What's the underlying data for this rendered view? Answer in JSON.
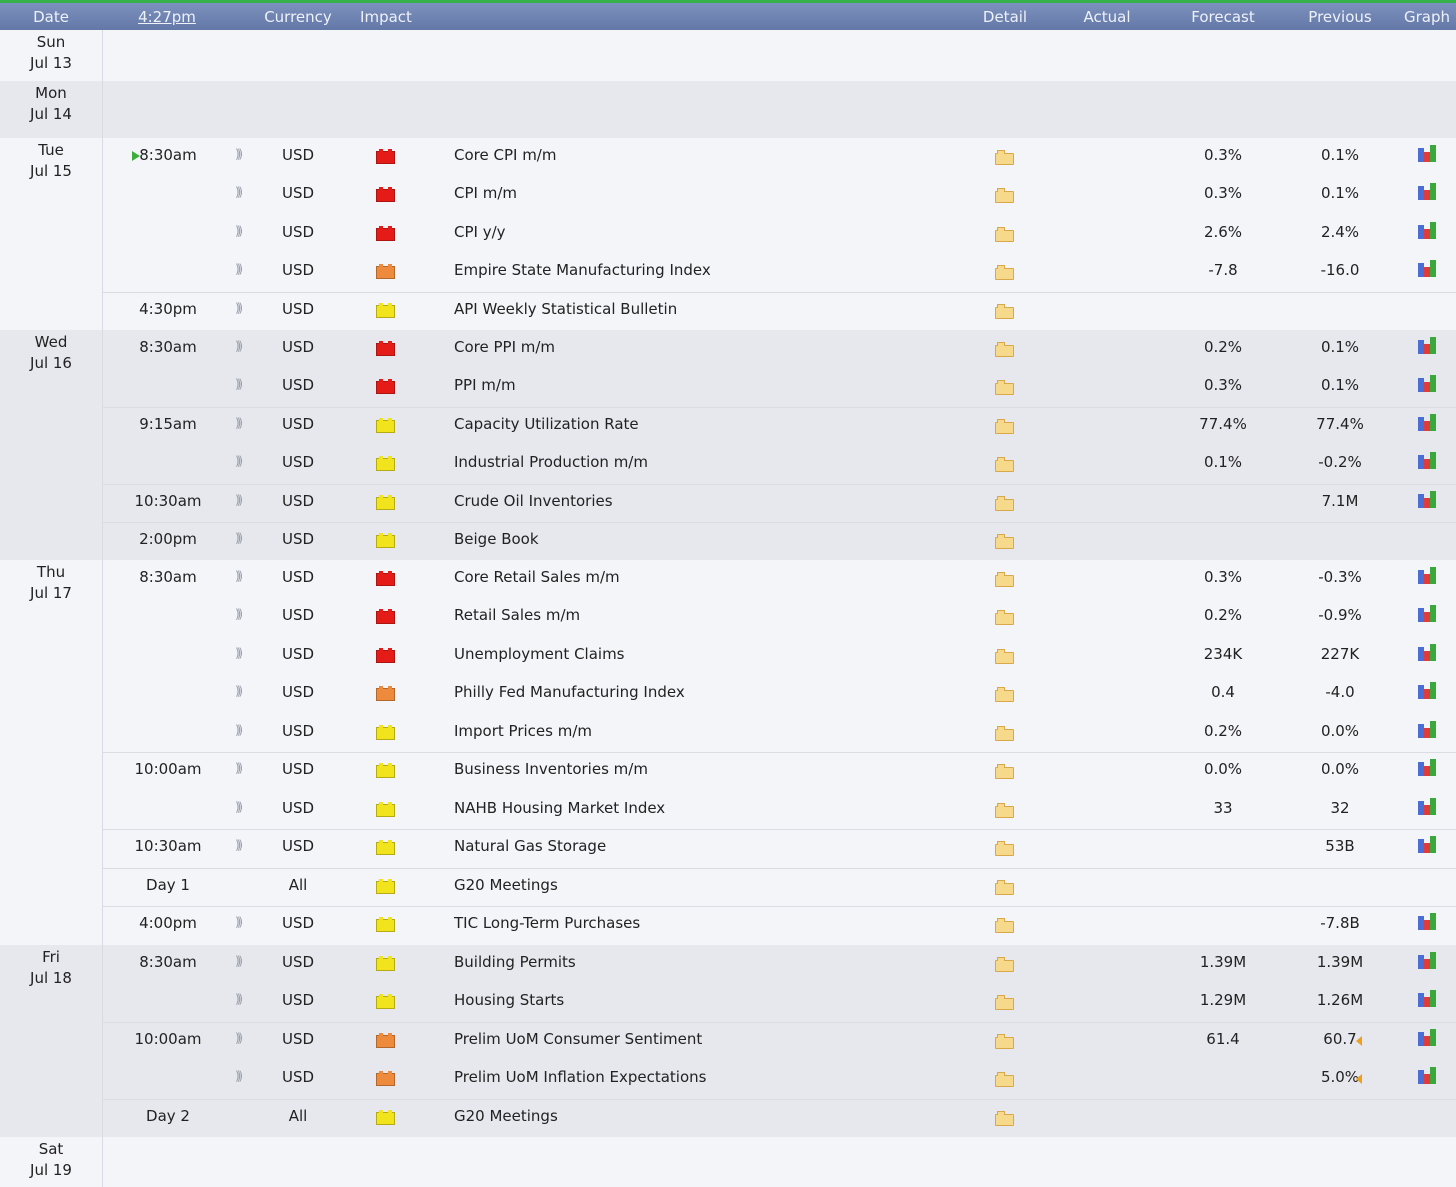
{
  "header": {
    "date": "Date",
    "time": "4:27pm",
    "currency": "Currency",
    "impact": "Impact",
    "detail": "Detail",
    "actual": "Actual",
    "forecast": "Forecast",
    "previous": "Previous",
    "graph": "Graph"
  },
  "colors": {
    "high": "#e41b17",
    "medium": "#ee8a3c",
    "low": "#f1e41c",
    "header": "#6f84b3",
    "top_accent": "#37b24a"
  },
  "days": [
    {
      "dow": "Sun",
      "date": "Jul 13",
      "rows": []
    },
    {
      "dow": "Mon",
      "date": "Jul 14",
      "rows": []
    },
    {
      "dow": "Tue",
      "date": "Jul 15",
      "rows": [
        {
          "time": "8:30am",
          "next": true,
          "currency": "USD",
          "impact": "high",
          "title": "Core CPI m/m",
          "forecast": "0.3%",
          "previous": "0.1%",
          "graph": true
        },
        {
          "time": "",
          "currency": "USD",
          "impact": "high",
          "title": "CPI m/m",
          "forecast": "0.3%",
          "previous": "0.1%",
          "graph": true
        },
        {
          "time": "",
          "currency": "USD",
          "impact": "high",
          "title": "CPI y/y",
          "forecast": "2.6%",
          "previous": "2.4%",
          "graph": true
        },
        {
          "time": "",
          "currency": "USD",
          "impact": "medium",
          "title": "Empire State Manufacturing Index",
          "forecast": "-7.8",
          "previous": "-16.0",
          "graph": true
        },
        {
          "time": "4:30pm",
          "sep": true,
          "currency": "USD",
          "impact": "low",
          "title": "API Weekly Statistical Bulletin",
          "forecast": "",
          "previous": "",
          "graph": false
        }
      ]
    },
    {
      "dow": "Wed",
      "date": "Jul 16",
      "rows": [
        {
          "time": "8:30am",
          "currency": "USD",
          "impact": "high",
          "title": "Core PPI m/m",
          "forecast": "0.2%",
          "previous": "0.1%",
          "graph": true
        },
        {
          "time": "",
          "currency": "USD",
          "impact": "high",
          "title": "PPI m/m",
          "forecast": "0.3%",
          "previous": "0.1%",
          "graph": true
        },
        {
          "time": "9:15am",
          "sep": true,
          "currency": "USD",
          "impact": "low",
          "title": "Capacity Utilization Rate",
          "forecast": "77.4%",
          "previous": "77.4%",
          "graph": true
        },
        {
          "time": "",
          "currency": "USD",
          "impact": "low",
          "title": "Industrial Production m/m",
          "forecast": "0.1%",
          "previous": "-0.2%",
          "graph": true
        },
        {
          "time": "10:30am",
          "sep": true,
          "currency": "USD",
          "impact": "low",
          "title": "Crude Oil Inventories",
          "forecast": "",
          "previous": "7.1M",
          "graph": true
        },
        {
          "time": "2:00pm",
          "sep": true,
          "currency": "USD",
          "impact": "low",
          "title": "Beige Book",
          "forecast": "",
          "previous": "",
          "graph": false
        }
      ]
    },
    {
      "dow": "Thu",
      "date": "Jul 17",
      "rows": [
        {
          "time": "8:30am",
          "currency": "USD",
          "impact": "high",
          "title": "Core Retail Sales m/m",
          "forecast": "0.3%",
          "previous": "-0.3%",
          "graph": true
        },
        {
          "time": "",
          "currency": "USD",
          "impact": "high",
          "title": "Retail Sales m/m",
          "forecast": "0.2%",
          "previous": "-0.9%",
          "graph": true
        },
        {
          "time": "",
          "currency": "USD",
          "impact": "high",
          "title": "Unemployment Claims",
          "forecast": "234K",
          "previous": "227K",
          "graph": true
        },
        {
          "time": "",
          "currency": "USD",
          "impact": "medium",
          "title": "Philly Fed Manufacturing Index",
          "forecast": "0.4",
          "previous": "-4.0",
          "graph": true
        },
        {
          "time": "",
          "currency": "USD",
          "impact": "low",
          "title": "Import Prices m/m",
          "forecast": "0.2%",
          "previous": "0.0%",
          "graph": true
        },
        {
          "time": "10:00am",
          "sep": true,
          "currency": "USD",
          "impact": "low",
          "title": "Business Inventories m/m",
          "forecast": "0.0%",
          "previous": "0.0%",
          "graph": true
        },
        {
          "time": "",
          "currency": "USD",
          "impact": "low",
          "title": "NAHB Housing Market Index",
          "forecast": "33",
          "previous": "32",
          "graph": true
        },
        {
          "time": "10:30am",
          "sep": true,
          "currency": "USD",
          "impact": "low",
          "title": "Natural Gas Storage",
          "forecast": "",
          "previous": "53B",
          "graph": true
        },
        {
          "time": "Day 1",
          "sep": true,
          "currency": "All",
          "nosound": true,
          "impact": "low",
          "title": "G20 Meetings",
          "forecast": "",
          "previous": "",
          "graph": false
        },
        {
          "time": "4:00pm",
          "sep": true,
          "currency": "USD",
          "impact": "low",
          "title": "TIC Long-Term Purchases",
          "forecast": "",
          "previous": "-7.8B",
          "graph": true
        }
      ]
    },
    {
      "dow": "Fri",
      "date": "Jul 18",
      "rows": [
        {
          "time": "8:30am",
          "currency": "USD",
          "impact": "low",
          "title": "Building Permits",
          "forecast": "1.39M",
          "previous": "1.39M",
          "graph": true
        },
        {
          "time": "",
          "currency": "USD",
          "impact": "low",
          "title": "Housing Starts",
          "forecast": "1.29M",
          "previous": "1.26M",
          "graph": true
        },
        {
          "time": "10:00am",
          "sep": true,
          "currency": "USD",
          "impact": "medium",
          "title": "Prelim UoM Consumer Sentiment",
          "forecast": "61.4",
          "previous": "60.7",
          "revised": true,
          "graph": true
        },
        {
          "time": "",
          "currency": "USD",
          "impact": "medium",
          "title": "Prelim UoM Inflation Expectations",
          "forecast": "",
          "previous": "5.0%",
          "revised": true,
          "graph": true
        },
        {
          "time": "Day 2",
          "sep": true,
          "currency": "All",
          "nosound": true,
          "impact": "low",
          "title": "G20 Meetings",
          "forecast": "",
          "previous": "",
          "graph": false
        }
      ]
    },
    {
      "dow": "Sat",
      "date": "Jul 19",
      "rows": []
    }
  ]
}
